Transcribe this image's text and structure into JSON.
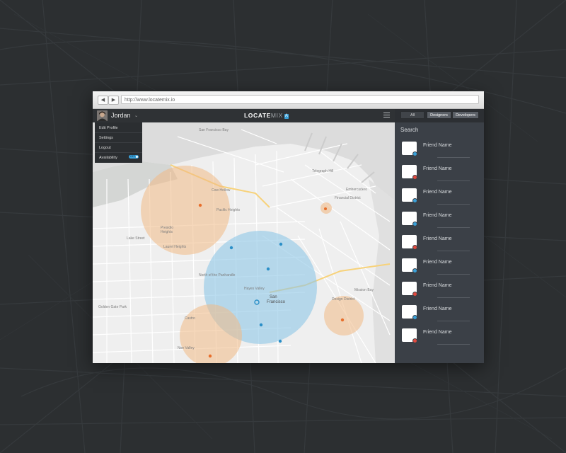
{
  "browser": {
    "back_glyph": "◀",
    "forward_glyph": "▶",
    "url": "http://www.locatemix.io"
  },
  "header": {
    "username": "Jordan",
    "caret_glyph": "⌄",
    "logo_main": "LOCATE",
    "logo_sub": "MIX",
    "logo_badge": "A"
  },
  "user_menu": {
    "items": [
      "Edit Profile",
      "Settings",
      "Logout",
      "Availability"
    ],
    "availability_toggle": "OFF"
  },
  "filters": {
    "tabs": [
      "All",
      "Designers",
      "Developers"
    ],
    "active": [
      "Designers",
      "Developers"
    ]
  },
  "sidebar": {
    "search_label": "Search",
    "friends": [
      {
        "name": "Friend Name",
        "status": "available"
      },
      {
        "name": "Friend Name",
        "status": "busy"
      },
      {
        "name": "Friend Name",
        "status": "available"
      },
      {
        "name": "Friend Name",
        "status": "available"
      },
      {
        "name": "Friend Name",
        "status": "busy"
      },
      {
        "name": "Friend Name",
        "status": "available"
      },
      {
        "name": "Friend Name",
        "status": "busy"
      },
      {
        "name": "Friend Name",
        "status": "available"
      },
      {
        "name": "Friend Name",
        "status": "busy"
      }
    ]
  },
  "colors": {
    "available": "#3aa0d8",
    "busy": "#e04a3f",
    "developer_zone": "#8ec6e6",
    "designer_zone": "#f0b985"
  },
  "map": {
    "labels": {
      "bay_top": "San Francisco Bay",
      "downtown_a": "San",
      "downtown_b": "Francisco",
      "presidio_a": "Presidio",
      "presidio_b": "Heights",
      "hill": "Cow Hollow",
      "pac": "Pacific Heights",
      "laurel": "Laurel Heights",
      "north": "North of the Panhandle",
      "hayes": "Hayes Valley",
      "castro": "Castro",
      "noe": "Noe Valley",
      "design": "Design District",
      "financial": "Financial District",
      "chinatown": "Telegraph Hill",
      "embarc": "Embarcadero",
      "mission_bay": "Mission Bay",
      "outer_a": "Lake Street",
      "outer_b": "Golden Gate Park"
    }
  }
}
